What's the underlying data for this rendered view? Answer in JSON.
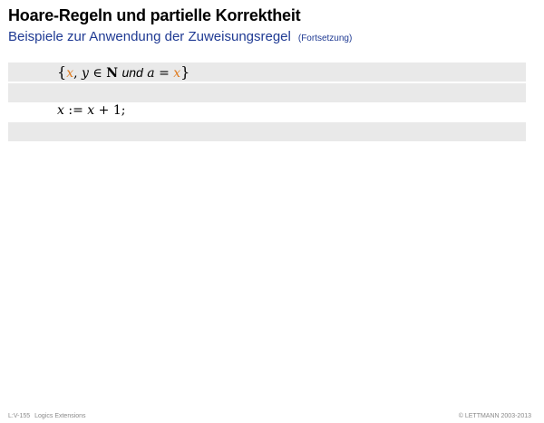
{
  "header": {
    "title": "Hoare-Regeln und partielle Korrektheit",
    "subtitle": "Beispiele zur Anwendung der Zuweisungsregel",
    "subtitle_note": "(Fortsetzung)"
  },
  "content": {
    "line1": {
      "open": "{",
      "x": "x",
      "comma": ",",
      "y": "y",
      "in": "∈",
      "N": "N",
      "und": "und",
      "a": "a",
      "eq": "=",
      "x2": "x",
      "close": "}"
    },
    "line2": {
      "x": "x",
      "assign": ":=",
      "x2": "x",
      "plus": "+",
      "one": "1",
      "semicolon": ";"
    }
  },
  "footer": {
    "slide_id": "L:V-155",
    "section": "Logics Extensions",
    "copyright": "© LETTMANN 2003-2013"
  },
  "colors": {
    "title": "#000000",
    "subtitle": "#1f3a93",
    "highlight_variable": "#e07b1f",
    "row_background": "#e9e9e9",
    "footer": "#8a8a8a"
  }
}
